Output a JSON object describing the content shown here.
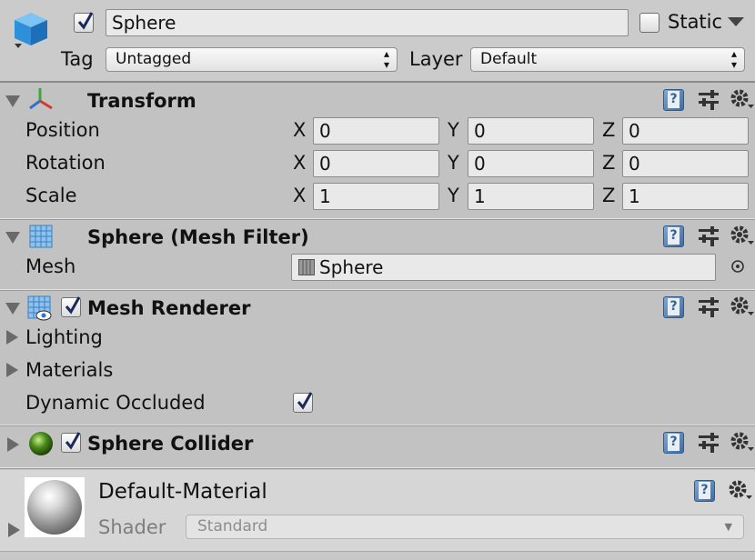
{
  "header": {
    "object_name": "Sphere",
    "active": true,
    "static_label": "Static",
    "static_checked": false,
    "tag_label": "Tag",
    "tag_value": "Untagged",
    "layer_label": "Layer",
    "layer_value": "Default"
  },
  "transform": {
    "title": "Transform",
    "rows": [
      {
        "label": "Position",
        "x": "0",
        "y": "0",
        "z": "0"
      },
      {
        "label": "Rotation",
        "x": "0",
        "y": "0",
        "z": "0"
      },
      {
        "label": "Scale",
        "x": "1",
        "y": "1",
        "z": "1"
      }
    ],
    "axis": {
      "x": "X",
      "y": "Y",
      "z": "Z"
    }
  },
  "mesh_filter": {
    "title": "Sphere (Mesh Filter)",
    "mesh_label": "Mesh",
    "mesh_value": "Sphere"
  },
  "mesh_renderer": {
    "title": "Mesh Renderer",
    "enabled": true,
    "lighting_label": "Lighting",
    "materials_label": "Materials",
    "dynamic_occluded_label": "Dynamic Occluded",
    "dynamic_occluded": true
  },
  "sphere_collider": {
    "title": "Sphere Collider",
    "enabled": true
  },
  "material": {
    "name": "Default-Material",
    "shader_label": "Shader",
    "shader_value": "Standard"
  },
  "icons": {
    "help": "help-book-icon",
    "preset": "preset-sliders-icon",
    "settings": "gear-icon",
    "object_picker": "object-picker-icon"
  },
  "colors": {
    "panel": "#c2c2c2",
    "header": "#cbcbcb",
    "help_blue": "#3b6da6",
    "collider_green": "#4a8a1c"
  }
}
